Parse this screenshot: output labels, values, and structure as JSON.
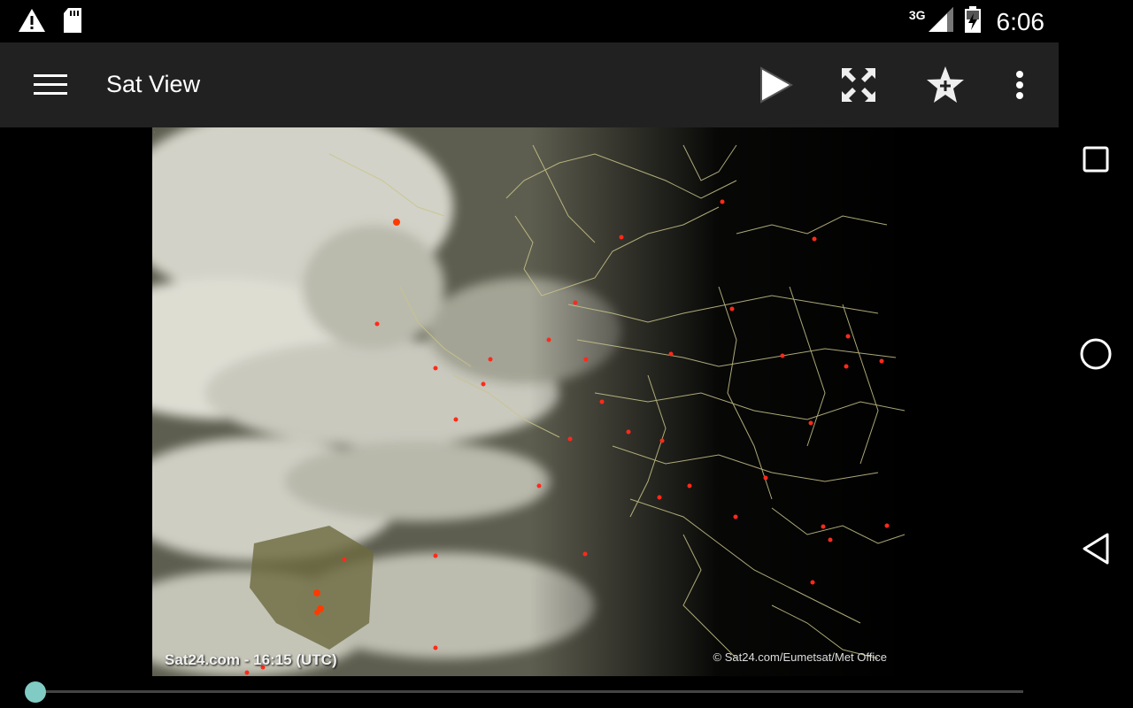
{
  "status_bar": {
    "icons": [
      "warning-icon",
      "sd-card-icon",
      "signal-icon",
      "battery-charging-icon"
    ],
    "network": "3G",
    "time": "6:06"
  },
  "app_bar": {
    "title": "Sat View",
    "actions": [
      "play-icon",
      "fullscreen-icon",
      "favorite-add-icon",
      "more-vert-icon"
    ]
  },
  "satellite": {
    "caption": "Sat24.com - 16:15 (UTC)",
    "credit": "© Sat24.com/Eumetsat/Met Office"
  },
  "timeline": {
    "position": 0.0
  },
  "nav": {
    "icons": [
      "recents-icon",
      "home-icon",
      "back-icon"
    ]
  },
  "colors": {
    "app_bar": "#212121",
    "accent": "#80cbc4",
    "background": "#000000"
  }
}
